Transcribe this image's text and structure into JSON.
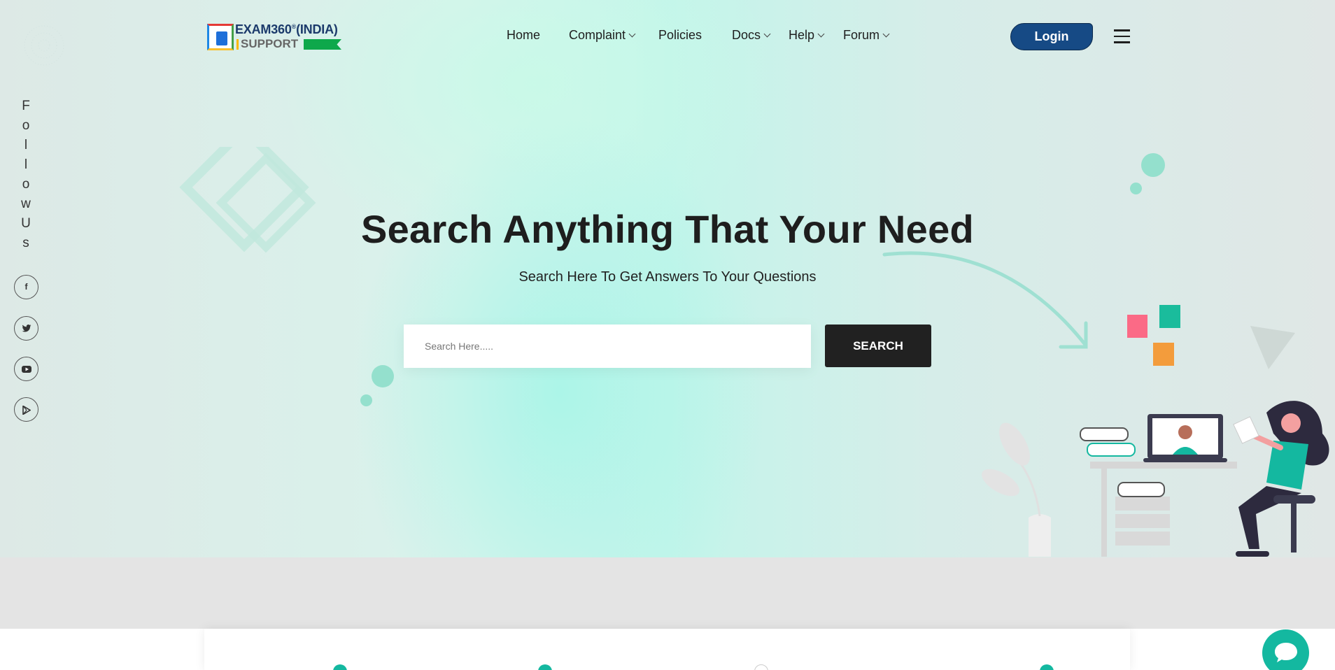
{
  "header": {
    "logo_line1": "EXAM360",
    "logo_reg": "®",
    "logo_line1b": "(INDIA)",
    "logo_line2": "SUPPORT",
    "nav": [
      {
        "label": "Home",
        "has_dropdown": false
      },
      {
        "label": "Complaint",
        "has_dropdown": true
      },
      {
        "label": "Policies",
        "has_dropdown": false
      },
      {
        "label": "Docs",
        "has_dropdown": true
      },
      {
        "label": "Help",
        "has_dropdown": true
      },
      {
        "label": "Forum",
        "has_dropdown": true
      }
    ],
    "login_label": "Login",
    "menu_icon": "hamburger-menu-icon"
  },
  "follow": {
    "letters": [
      "F",
      "o",
      "l",
      "l",
      "o",
      "w",
      "U",
      "s"
    ],
    "social": [
      {
        "name": "facebook-icon",
        "glyph": "f"
      },
      {
        "name": "twitter-icon",
        "glyph": "t"
      },
      {
        "name": "youtube-icon",
        "glyph": "▶"
      },
      {
        "name": "google-play-icon",
        "glyph": "▷"
      }
    ]
  },
  "hero": {
    "title": "Search Anything That Your Need",
    "subtitle": "Search Here To Get Answers To Your Questions",
    "search_placeholder": "Search Here.....",
    "search_button": "SEARCH"
  },
  "colors": {
    "accent": "#14b8a0",
    "login_bg": "#164a85",
    "search_btn_bg": "#212121",
    "pink_square": "#fb6a86",
    "teal_square": "#1abc9c",
    "orange_square": "#f39c3c"
  },
  "chat": {
    "icon": "chat-bubble-icon"
  }
}
